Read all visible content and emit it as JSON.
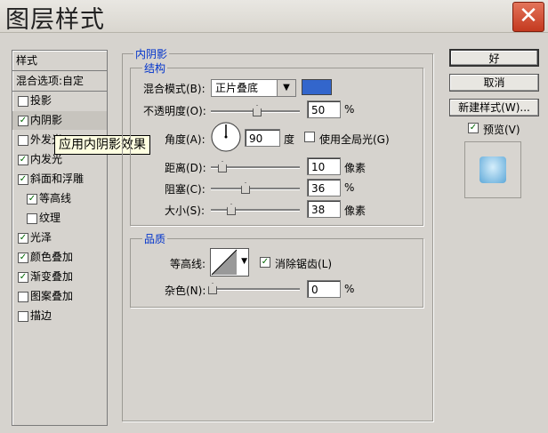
{
  "window": {
    "title": "图层样式",
    "close_glyph": "✕"
  },
  "styles_list": {
    "header": "样式",
    "blend_options": "混合选项:自定",
    "items": [
      {
        "label": "投影",
        "checked": false
      },
      {
        "label": "内阴影",
        "checked": true,
        "selected": true
      },
      {
        "label": "外发光",
        "checked": false
      },
      {
        "label": "内发光",
        "checked": true
      },
      {
        "label": "斜面和浮雕",
        "checked": true
      },
      {
        "label": "等高线",
        "checked": true,
        "indent": true
      },
      {
        "label": "纹理",
        "checked": false,
        "indent": true
      },
      {
        "label": "光泽",
        "checked": true
      },
      {
        "label": "颜色叠加",
        "checked": true
      },
      {
        "label": "渐变叠加",
        "checked": true
      },
      {
        "label": "图案叠加",
        "checked": false
      },
      {
        "label": "描边",
        "checked": false
      }
    ]
  },
  "tooltip": "应用内阴影效果",
  "panel": {
    "title": "内阴影",
    "structure": {
      "title": "结构",
      "blend_mode_label": "混合模式(B):",
      "blend_mode_value": "正片叠底",
      "color": "#3366cc",
      "opacity_label": "不透明度(O):",
      "opacity_value": "50",
      "opacity_unit": "%",
      "angle_label": "角度(A):",
      "angle_value": "90",
      "angle_unit": "度",
      "global_light_label": "使用全局光(G)",
      "global_light_checked": false,
      "distance_label": "距离(D):",
      "distance_value": "10",
      "distance_unit": "像素",
      "choke_label": "阻塞(C):",
      "choke_value": "36",
      "choke_unit": "%",
      "size_label": "大小(S):",
      "size_value": "38",
      "size_unit": "像素"
    },
    "quality": {
      "title": "品质",
      "contour_label": "等高线:",
      "anti_alias_label": "消除锯齿(L)",
      "anti_alias_checked": true,
      "noise_label": "杂色(N):",
      "noise_value": "0",
      "noise_unit": "%"
    }
  },
  "buttons": {
    "ok": "好",
    "cancel": "取消",
    "new_style": "新建样式(W)...",
    "preview_label": "预览(V)",
    "preview_checked": true
  }
}
